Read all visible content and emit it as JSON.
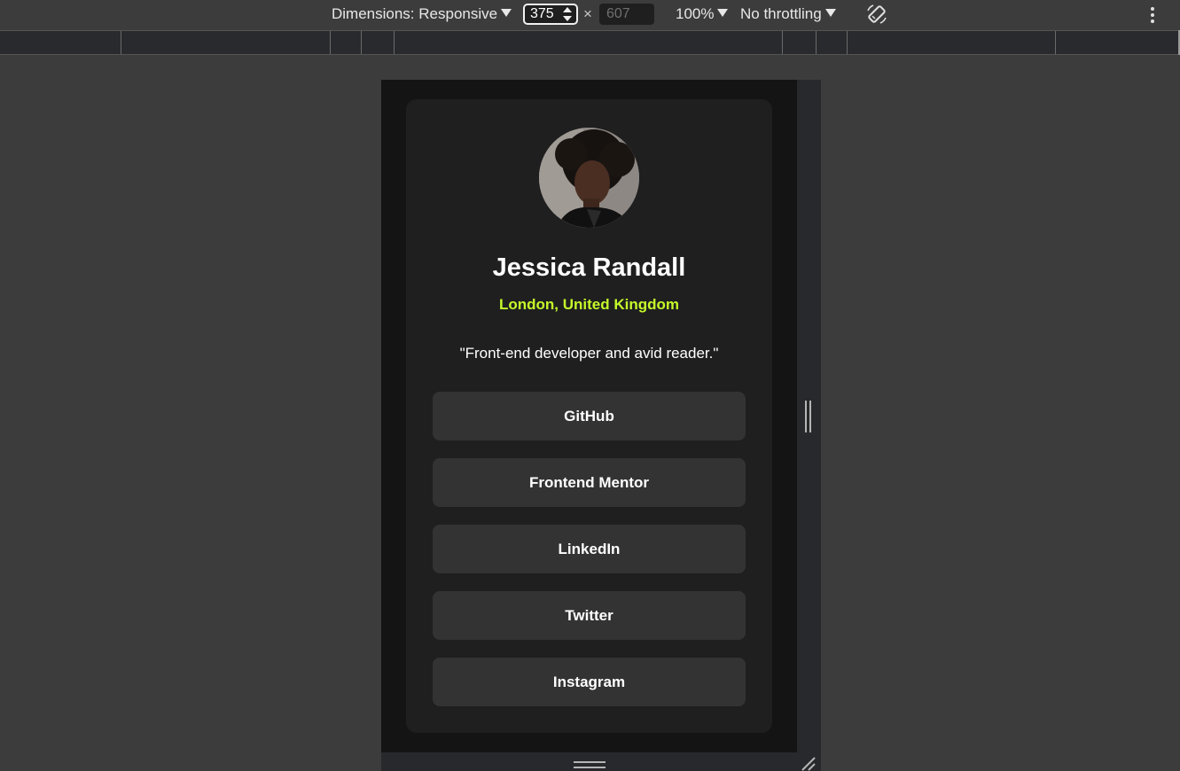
{
  "toolbar": {
    "dimensions_label": "Dimensions: Responsive",
    "width_value": "375",
    "height_placeholder": "607",
    "times": "×",
    "zoom": "100%",
    "throttling": "No throttling",
    "icons": [
      "caret-down-icon",
      "stepper-icon",
      "rotate-icon",
      "more-vert-icon"
    ]
  },
  "profile": {
    "name": "Jessica Randall",
    "location": "London, United Kingdom",
    "bio": "\"Front-end developer and avid reader.\"",
    "links": [
      "GitHub",
      "Frontend Mentor",
      "LinkedIn",
      "Twitter",
      "Instagram"
    ]
  },
  "colors": {
    "accent": "#c5f82a",
    "card": "#1f1f1f",
    "page": "#141414",
    "button": "#333333",
    "chrome": "#3c3c3c"
  }
}
